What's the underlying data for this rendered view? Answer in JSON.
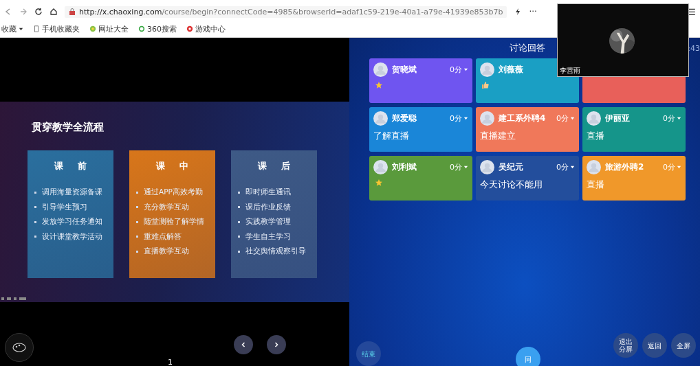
{
  "browser": {
    "url_host": "http://x.chaoxing.com",
    "url_path": "/course/begin?connectCode=4985&browserId=adaf1c59-219e-40a1-a79e-41939e853b7b",
    "bookmarks": [
      {
        "label": "收藏",
        "kind": "menu"
      },
      {
        "label": "手机收藏夹",
        "kind": "phone"
      },
      {
        "label": "网址大全",
        "kind": "globe"
      },
      {
        "label": "360搜索",
        "kind": "ring"
      },
      {
        "label": "游戏中心",
        "kind": "game"
      }
    ],
    "more": "···",
    "menu": "☰"
  },
  "slide": {
    "title": "贯穿教学全流程",
    "columns": [
      {
        "heading": "课前",
        "color": "#2a6f9e",
        "items": [
          "调用海量资源备课",
          "引导学生预习",
          "发放学习任务通知",
          "设计课堂教学活动"
        ]
      },
      {
        "heading": "课中",
        "color": "#d8761a",
        "items": [
          "通过APP高效考勤",
          "充分教学互动",
          "随堂测验了解学情",
          "重难点解答",
          "直播教学互动"
        ]
      },
      {
        "heading": "课后",
        "color": "#3e5a86",
        "items": [
          "即时师生通讯",
          "课后作业反馈",
          "实践教学管理",
          "学生自主学习",
          "社交舆情观察引导"
        ]
      }
    ]
  },
  "page_number": "1",
  "discussion": {
    "title": "讨论回答",
    "timer": ":43",
    "cards": [
      {
        "kind": "star",
        "color": "#6f55f0",
        "name": "贺晓斌",
        "score": "0分"
      },
      {
        "kind": "thumb",
        "color": "#1a9fc4",
        "name": "刘薇薇"
      },
      {
        "kind": "covered",
        "color": "#e8605a"
      },
      {
        "kind": "text",
        "color": "#1a86d8",
        "name": "郑爱聪",
        "score": "0分",
        "answer": "了解直播"
      },
      {
        "kind": "text",
        "color": "#f0785a",
        "name": "建工系外聘4",
        "score": "0分",
        "answer": "直播建立"
      },
      {
        "kind": "text",
        "color": "#15958a",
        "name": "伊丽亚",
        "score": "0分",
        "answer": "直播"
      },
      {
        "kind": "star",
        "color": "#5a9a3c",
        "name": "刘利斌",
        "score": "0分"
      },
      {
        "kind": "text",
        "color": "#234e9c",
        "name": "吴纪元",
        "score": "0分",
        "answer": "今天讨论不能用"
      },
      {
        "kind": "text",
        "color": "#f0982a",
        "name": "旅游外聘2",
        "score": "0分",
        "answer": "直播"
      }
    ]
  },
  "video": {
    "caption": "李营雨"
  },
  "buttons": {
    "end": "结束",
    "sync": "同",
    "exit_split": "退出分屏",
    "back": "返回",
    "fullscreen": "全屏"
  }
}
